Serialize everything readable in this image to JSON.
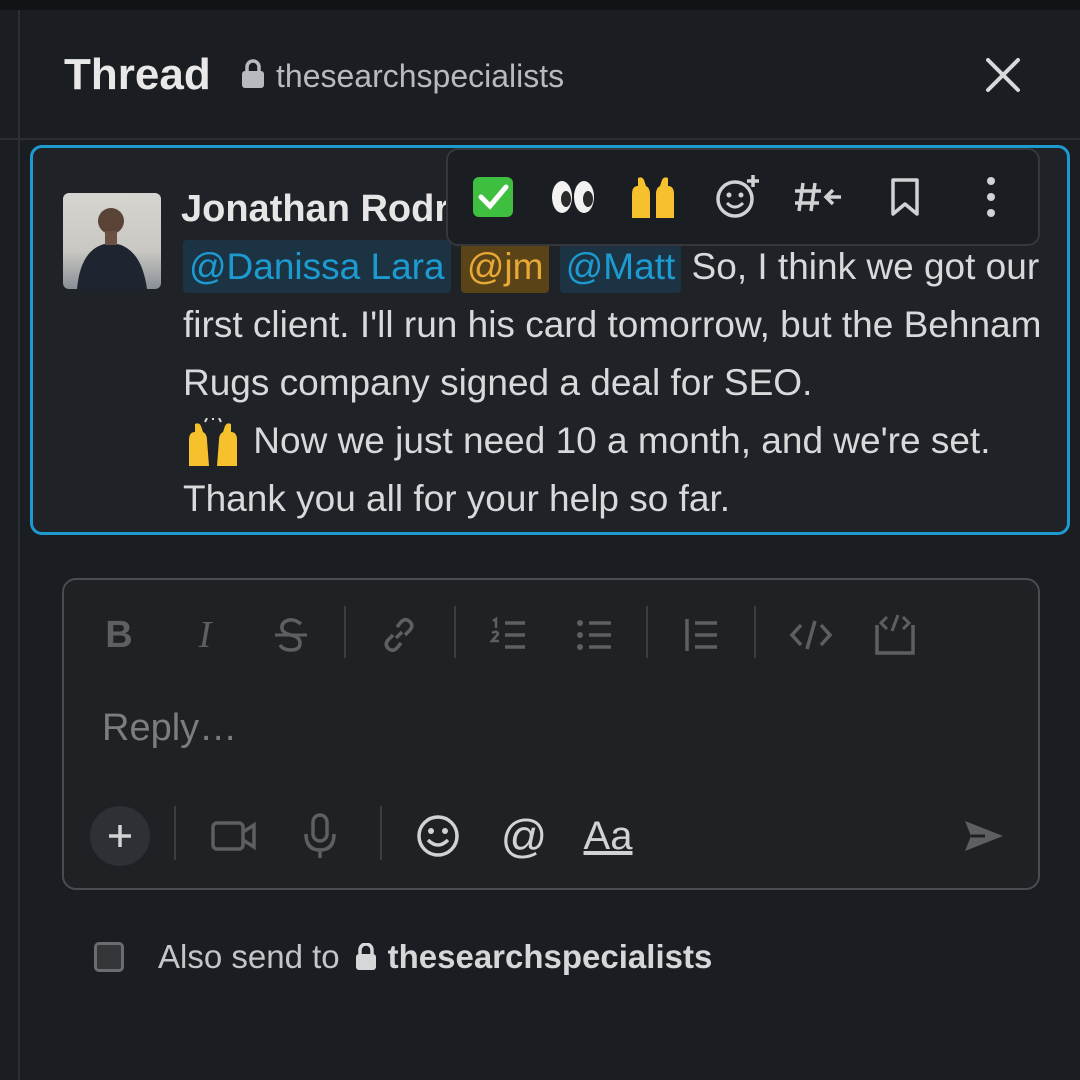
{
  "header": {
    "title": "Thread",
    "channel": "thesearchspecialists",
    "close_icon": "close-icon"
  },
  "message": {
    "author": "Jonathan Rodri",
    "mentions": [
      "@Danissa Lara",
      "@jm",
      "@Matt"
    ],
    "text_after_mentions": " So, I think we got our first client. I'll run his card tomorrow, but the Behnam Rugs company signed a deal for SEO.",
    "text_after_emoji": " Now we just need 10 a month, and we're set. Thank you all for your help so far.",
    "inline_emoji": "raised-hands-emoji",
    "border_color": "#1d9bd1"
  },
  "message_actions": [
    {
      "name": "react-check-mark",
      "icon": "check-mark-emoji"
    },
    {
      "name": "react-eyes",
      "icon": "eyes-emoji"
    },
    {
      "name": "react-raised-hands",
      "icon": "raised-hands-emoji"
    },
    {
      "name": "add-reaction",
      "icon": "add-reaction-icon"
    },
    {
      "name": "reply-in-channel",
      "icon": "hash-arrow-icon"
    },
    {
      "name": "save-for-later",
      "icon": "bookmark-icon"
    },
    {
      "name": "more-actions",
      "icon": "more-vertical-icon"
    }
  ],
  "composer": {
    "placeholder": "Reply…",
    "format_tools": [
      "bold-icon",
      "italic-icon",
      "strikethrough-icon",
      "link-icon",
      "ordered-list-icon",
      "bulleted-list-icon",
      "blockquote-icon",
      "code-icon",
      "code-block-icon"
    ],
    "format_labels": {
      "bold": "B",
      "italic": "I"
    },
    "bottom_tools": [
      "plus-icon",
      "video-icon",
      "microphone-icon",
      "emoji-icon",
      "mention-icon",
      "formatting-icon",
      "send-icon"
    ],
    "mention_symbol": "@",
    "formatting_label": "Aa"
  },
  "also_send": {
    "label": "Also send to",
    "channel": "thesearchspecialists",
    "checked": false
  },
  "colors": {
    "background": "#1a1d21",
    "accent": "#1d9bd1",
    "mention_bg": "#1c3344",
    "self_mention_bg": "#5a4417",
    "self_mention_text": "#e8a835"
  }
}
